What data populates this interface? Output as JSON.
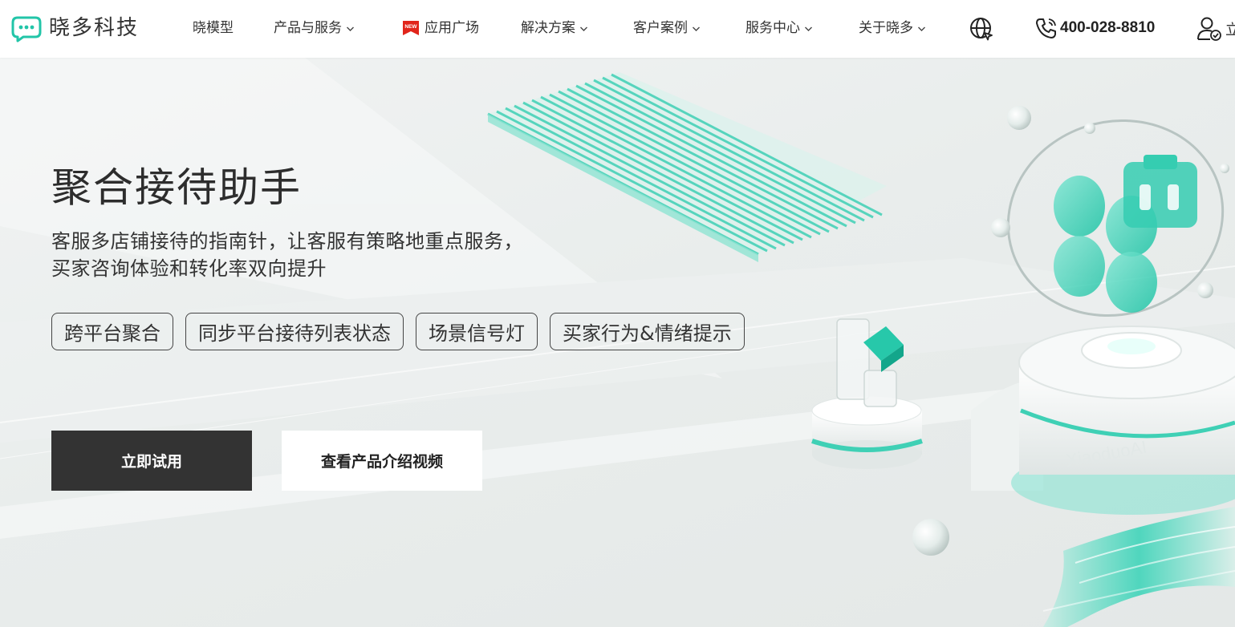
{
  "brand": {
    "name": "晓多科技",
    "accent_color": "#22c5a8"
  },
  "nav": {
    "items": [
      {
        "label": "晓模型",
        "dropdown": false
      },
      {
        "label": "产品与服务",
        "dropdown": true
      },
      {
        "label": "应用广场",
        "dropdown": false,
        "badge": "NEW"
      },
      {
        "label": "解决方案",
        "dropdown": true
      },
      {
        "label": "客户案例",
        "dropdown": true
      },
      {
        "label": "服务中心",
        "dropdown": true
      },
      {
        "label": "关于晓多",
        "dropdown": true
      }
    ],
    "language_icon": "globe-icon",
    "phone_icon": "phone-icon",
    "phone": "400-028-8810",
    "user_icon": "user-icon",
    "user_label": "立"
  },
  "hero": {
    "title": "聚合接待助手",
    "subtitle_lines": [
      "客服多店铺接待的指南针，让客服有策略地重点服务，",
      "买家咨询体验和转化率双向提升"
    ],
    "tags": [
      "跨平台聚合",
      "同步平台接待列表状态",
      "场景信号灯",
      "买家行为&情绪提示"
    ],
    "primary_button": "立即试用",
    "secondary_button": "查看产品介绍视频",
    "art_watermark": "XiaoduoAI"
  }
}
